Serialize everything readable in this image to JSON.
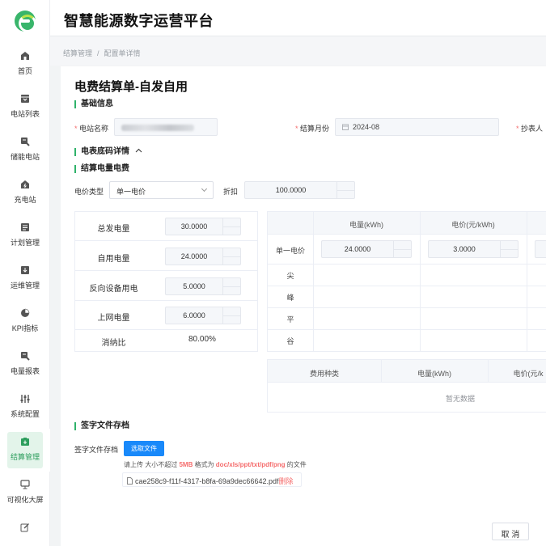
{
  "app": {
    "title": "智慧能源数字运营平台"
  },
  "nav": [
    {
      "label": "首页",
      "icon": "home-icon"
    },
    {
      "label": "电站列表",
      "icon": "station-list-icon"
    },
    {
      "label": "储能电站",
      "icon": "storage-icon"
    },
    {
      "label": "充电站",
      "icon": "charging-icon"
    },
    {
      "label": "计划管理",
      "icon": "plan-icon"
    },
    {
      "label": "运维管理",
      "icon": "maintenance-icon"
    },
    {
      "label": "KPI指标",
      "icon": "pie-chart-icon"
    },
    {
      "label": "电量报表",
      "icon": "report-icon"
    },
    {
      "label": "系统配置",
      "icon": "sliders-icon"
    },
    {
      "label": "结算管理",
      "icon": "settlement-icon",
      "active": true
    },
    {
      "label": "可视化大屏",
      "icon": "monitor-icon"
    },
    {
      "label": "",
      "icon": "edit-icon"
    }
  ],
  "breadcrumb": {
    "parent": "结算管理",
    "separator": "/",
    "current": "配置单详情"
  },
  "page": {
    "title": "电费结算单-自发自用"
  },
  "basic": {
    "section": "基础信息",
    "station_label": "电站名称",
    "month_label": "结算月份",
    "month_value": "2024-08",
    "reader_label": "抄表人"
  },
  "meter": {
    "section": "电表底码详情"
  },
  "settle": {
    "section": "结算电量电费",
    "price_type_label": "电价类型",
    "price_type_value": "单一电价",
    "discount_label": "折扣",
    "discount_value": "100.0000",
    "rows": [
      {
        "label": "总发电量",
        "value": "30.0000"
      },
      {
        "label": "自用电量",
        "value": "24.0000"
      },
      {
        "label": "反向设备用电",
        "value": "5.0000"
      },
      {
        "label": "上网电量",
        "value": "6.0000"
      }
    ],
    "ratio_label": "消纳比",
    "ratio_value": "80.00%",
    "table": {
      "col_energy": "电量(kWh)",
      "col_price": "电价(元/kWh)",
      "rows": [
        "单一电价",
        "尖",
        "峰",
        "平",
        "谷"
      ],
      "single_energy": "24.0000",
      "single_price": "3.0000"
    },
    "fee_table": {
      "col_type": "费用种类",
      "col_energy": "电量(kWh)",
      "col_price": "电价(元/k",
      "empty": "暂无数据"
    }
  },
  "sign": {
    "section": "签字文件存档",
    "label": "签字文件存档",
    "button": "选取文件",
    "hint_pre": "请上传 大小不超过 ",
    "hint_size": "5MB",
    "hint_mid": " 格式为 ",
    "hint_formats": "doc/xls/ppt/txt/pdf/png",
    "hint_post": " 的文件",
    "file_name": "cae258c9-f11f-4317-b8fa-69a9dec66642.pdf",
    "delete": "删除"
  },
  "footer": {
    "cancel": "取 消"
  },
  "colors": {
    "accent": "#2fb26a",
    "primary": "#1989fa",
    "danger": "#f56c6c"
  }
}
